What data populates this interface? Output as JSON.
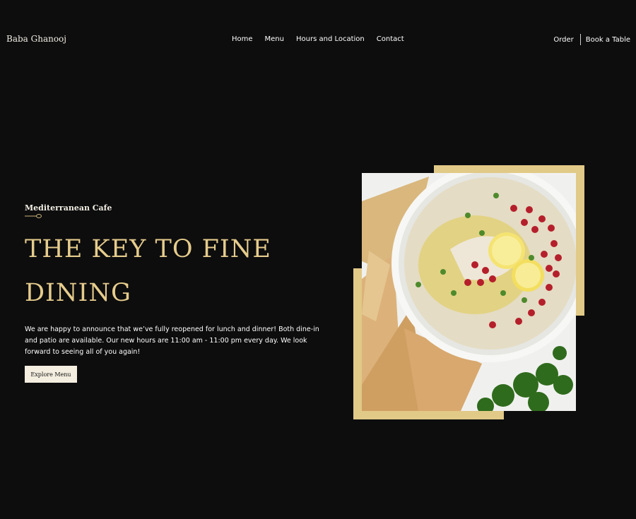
{
  "header": {
    "brand": "Baba Ghanooj",
    "nav": [
      "Home",
      "Menu",
      "Hours and Location",
      "Contact"
    ],
    "actions": {
      "order": "Order",
      "book": "Book a Table"
    }
  },
  "hero": {
    "eyebrow": "Mediterranean Cafe",
    "headline": "THE KEY TO FINE DINING",
    "intro": "We are happy to announce that we’ve fully reopened for lunch and dinner! Both dine-in and patio are available. Our new hours are 11:00 am - 11:00 pm every day. We look forward to seeing all of you again!",
    "cta": "Explore Menu"
  },
  "colors": {
    "background": "#0d0d0e",
    "accent_gold": "#e6cc8c",
    "frame_gold": "#e1c987",
    "button_bg": "#f4eee0"
  },
  "icons": {
    "divider": "spoon-icon"
  }
}
